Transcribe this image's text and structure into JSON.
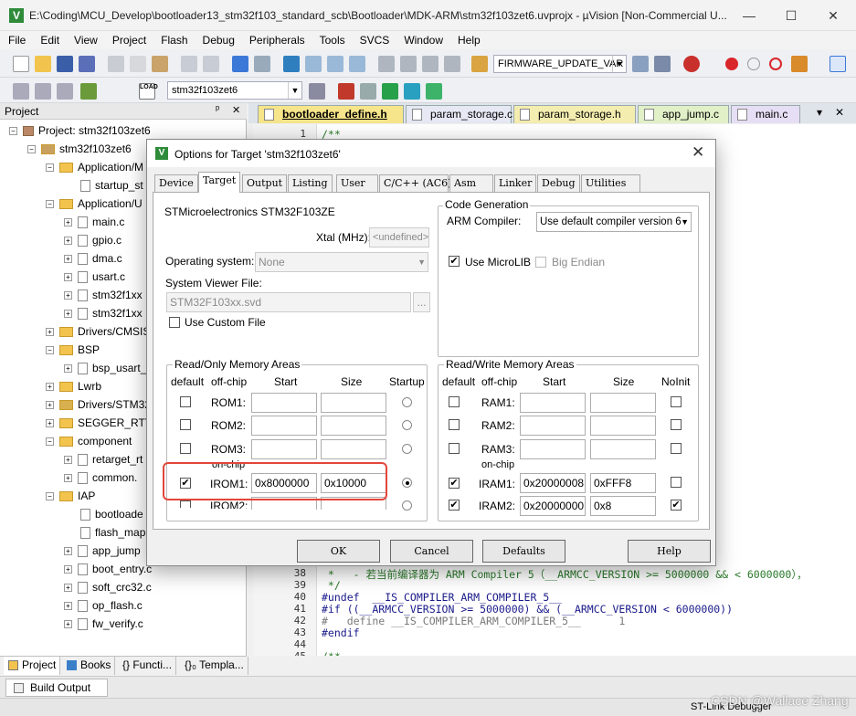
{
  "window": {
    "title": "E:\\Coding\\MCU_Develop\\bootloader13_stm32f103_standard_scb\\Bootloader\\MDK-ARM\\stm32f103zet6.uvprojx - µVision  [Non-Commercial U...",
    "minimize": "—",
    "maximize": "☐",
    "close": "✕"
  },
  "menu": [
    "File",
    "Edit",
    "View",
    "Project",
    "Flash",
    "Debug",
    "Peripherals",
    "Tools",
    "SVCS",
    "Window",
    "Help"
  ],
  "toolbar1": {
    "target_combo": "FIRMWARE_UPDATE_VAR"
  },
  "toolbar2": {
    "target_select": "stm32f103zet6",
    "load_label": "LOAD"
  },
  "project_panel": {
    "title": "Project",
    "pin": "ᵖ",
    "close": "✕",
    "items": [
      {
        "label": "Project: stm32f103zet6"
      },
      {
        "label": "stm32f103zet6"
      },
      {
        "label": "Application/M"
      },
      {
        "label": "startup_st"
      },
      {
        "label": "Application/U"
      },
      {
        "label": "main.c"
      },
      {
        "label": "gpio.c"
      },
      {
        "label": "dma.c"
      },
      {
        "label": "usart.c"
      },
      {
        "label": "stm32f1xx"
      },
      {
        "label": "stm32f1xx"
      },
      {
        "label": "Drivers/CMSIS"
      },
      {
        "label": "BSP"
      },
      {
        "label": "bsp_usart_"
      },
      {
        "label": "Lwrb"
      },
      {
        "label": "Drivers/STM32"
      },
      {
        "label": "SEGGER_RTT"
      },
      {
        "label": "component"
      },
      {
        "label": "retarget_rt"
      },
      {
        "label": "common."
      },
      {
        "label": "IAP"
      },
      {
        "label": "bootloade"
      },
      {
        "label": "flash_map"
      },
      {
        "label": "app_jump"
      },
      {
        "label": "boot_entry.c"
      },
      {
        "label": "soft_crc32.c"
      },
      {
        "label": "op_flash.c"
      },
      {
        "label": "fw_verify.c"
      }
    ],
    "tabs": [
      "Project",
      "Books",
      "{} Functi...",
      "{}₀ Templa..."
    ]
  },
  "editor": {
    "tabs": [
      "bootloader_define.h",
      "param_storage.c",
      "param_storage.h",
      "app_jump.c",
      "main.c"
    ],
    "tab_menu": "▾",
    "tab_close": "✕",
    "top_line_number": "1",
    "top_line": "/**",
    "lines": [
      {
        "n": "38",
        "t": " *   - 若当前编译器为 ARM Compiler 5（__ARMCC_VERSION >= 5000000 && < 6000000），"
      },
      {
        "n": "39",
        "t": " */"
      },
      {
        "n": "40",
        "t": "#undef  __IS_COMPILER_ARM_COMPILER_5__"
      },
      {
        "n": "41",
        "t": "#if ((__ARMCC_VERSION >= 5000000) && (__ARMCC_VERSION < 6000000))"
      },
      {
        "n": "42",
        "t": "#   define __IS_COMPILER_ARM_COMPILER_5__      1"
      },
      {
        "n": "43",
        "t": "#endif"
      },
      {
        "n": "44",
        "t": ""
      },
      {
        "n": "45",
        "t": "/**"
      }
    ]
  },
  "bottom": {
    "build_output_tab": "Build Output",
    "status_right": "ST-Link Debugger",
    "watermark": "CSDN @Wallace Zhang"
  },
  "dialog": {
    "title": "Options for Target 'stm32f103zet6'",
    "close": "✕",
    "tabs": [
      "Device",
      "Target",
      "Output",
      "Listing",
      "User",
      "C/C++ (AC6)",
      "Asm",
      "Linker",
      "Debug",
      "Utilities"
    ],
    "active_tab": "Target",
    "device_name": "STMicroelectronics STM32F103ZE",
    "xtal_label": "Xtal (MHz):",
    "xtal_value": "<undefined>",
    "os_label": "Operating system:",
    "os_value": "None",
    "svd_label": "System Viewer File:",
    "svd_value": "STM32F103xx.svd",
    "browse": "...",
    "use_custom_file": "Use Custom File",
    "code_gen": {
      "title": "Code Generation",
      "compiler_label": "ARM Compiler:",
      "compiler_value": "Use default compiler version 6",
      "use_microlib": "Use MicroLIB",
      "big_endian": "Big Endian"
    },
    "ro_group": {
      "title": "Read/Only Memory Areas",
      "headers": {
        "default": "default",
        "offchip": "off-chip",
        "start": "Start",
        "size": "Size",
        "startup": "Startup"
      },
      "onchip_label": "on-chip",
      "rows": [
        {
          "name": "ROM1:",
          "start": "",
          "size": "",
          "default": false,
          "startup": false
        },
        {
          "name": "ROM2:",
          "start": "",
          "size": "",
          "default": false,
          "startup": false
        },
        {
          "name": "ROM3:",
          "start": "",
          "size": "",
          "default": false,
          "startup": false
        },
        {
          "name": "IROM1:",
          "start": "0x8000000",
          "size": "0x10000",
          "default": true,
          "startup": true
        },
        {
          "name": "IROM2:",
          "start": "",
          "size": "",
          "default": false,
          "startup": false
        }
      ]
    },
    "rw_group": {
      "title": "Read/Write Memory Areas",
      "headers": {
        "default": "default",
        "offchip": "off-chip",
        "start": "Start",
        "size": "Size",
        "noinit": "NoInit"
      },
      "onchip_label": "on-chip",
      "rows": [
        {
          "name": "RAM1:",
          "start": "",
          "size": "",
          "default": false,
          "noinit": false
        },
        {
          "name": "RAM2:",
          "start": "",
          "size": "",
          "default": false,
          "noinit": false
        },
        {
          "name": "RAM3:",
          "start": "",
          "size": "",
          "default": false,
          "noinit": false
        },
        {
          "name": "IRAM1:",
          "start": "0x20000008",
          "size": "0xFFF8",
          "default": true,
          "noinit": false
        },
        {
          "name": "IRAM2:",
          "start": "0x20000000",
          "size": "0x8",
          "default": true,
          "noinit": true
        }
      ]
    },
    "buttons": {
      "ok": "OK",
      "cancel": "Cancel",
      "defaults": "Defaults",
      "help": "Help"
    },
    "check_mark": "✔"
  },
  "colors": {
    "highlight": "#e2463a",
    "accent": "#2e8b3a",
    "active_tab": "#f6e58a"
  }
}
